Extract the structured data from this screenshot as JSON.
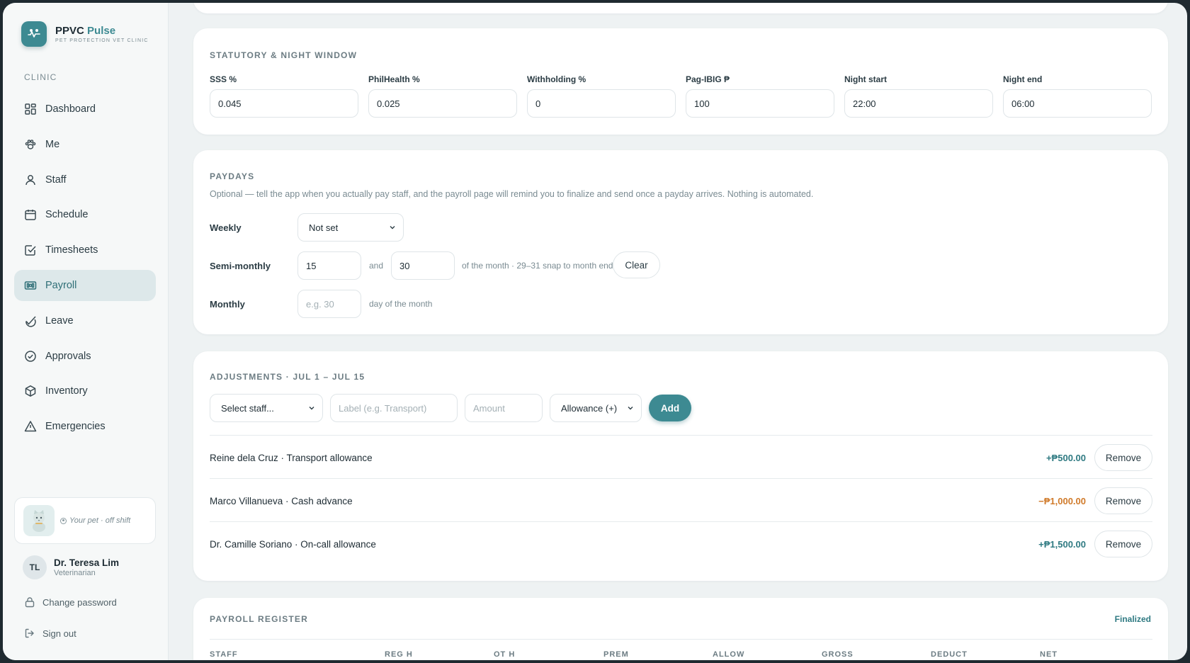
{
  "brand": {
    "name": "PPVC",
    "name_accent": "Pulse",
    "subtitle": "PET PROTECTION VET CLINIC"
  },
  "sidebar": {
    "section_label": "CLINIC",
    "items": [
      {
        "label": "Dashboard",
        "icon": "dashboard-icon"
      },
      {
        "label": "Me",
        "icon": "paw-icon"
      },
      {
        "label": "Staff",
        "icon": "user-icon"
      },
      {
        "label": "Schedule",
        "icon": "calendar-icon"
      },
      {
        "label": "Timesheets",
        "icon": "checkbox-icon"
      },
      {
        "label": "Payroll",
        "icon": "banknote-icon",
        "active": true
      },
      {
        "label": "Leave",
        "icon": "leave-icon"
      },
      {
        "label": "Approvals",
        "icon": "check-circle-icon"
      },
      {
        "label": "Inventory",
        "icon": "box-icon"
      },
      {
        "label": "Emergencies",
        "icon": "warning-icon"
      }
    ],
    "pet_status": "Your pet · off shift",
    "user": {
      "initials": "TL",
      "name": "Dr. Teresa Lim",
      "role": "Veterinarian"
    },
    "change_password": "Change password",
    "sign_out": "Sign out"
  },
  "statutory": {
    "title": "STATUTORY & NIGHT WINDOW",
    "fields": [
      {
        "label": "SSS %",
        "value": "0.045"
      },
      {
        "label": "PhilHealth %",
        "value": "0.025"
      },
      {
        "label": "Withholding %",
        "value": "0"
      },
      {
        "label": "Pag-IBIG ₱",
        "value": "100"
      },
      {
        "label": "Night start",
        "value": "22:00"
      },
      {
        "label": "Night end",
        "value": "06:00"
      }
    ]
  },
  "paydays": {
    "title": "PAYDAYS",
    "description": "Optional — tell the app when you actually pay staff, and the payroll page will remind you to finalize and send once a payday arrives. Nothing is automated.",
    "weekly_label": "Weekly",
    "weekly_value": "Not set",
    "semi_label": "Semi-monthly",
    "semi_first": "15",
    "semi_and": "and",
    "semi_second": "30",
    "semi_hint": "of the month · 29–31 snap to month end",
    "clear_label": "Clear",
    "monthly_label": "Monthly",
    "monthly_placeholder": "e.g. 30",
    "monthly_hint": "day of the month"
  },
  "adjustments": {
    "title": "ADJUSTMENTS · JUL 1 – JUL 15",
    "staff_select": "Select staff...",
    "label_placeholder": "Label (e.g. Transport)",
    "amount_placeholder": "Amount",
    "type_select": "Allowance (+)",
    "add_label": "Add",
    "rows": [
      {
        "text": "Reine dela Cruz · Transport allowance",
        "amount": "+₱500.00",
        "kind": "pos",
        "action": "Remove"
      },
      {
        "text": "Marco Villanueva · Cash advance",
        "amount": "−₱1,000.00",
        "kind": "neg",
        "action": "Remove"
      },
      {
        "text": "Dr. Camille Soriano · On-call allowance",
        "amount": "+₱1,500.00",
        "kind": "pos",
        "action": "Remove"
      }
    ]
  },
  "register": {
    "title": "PAYROLL REGISTER",
    "status": "Finalized",
    "columns": [
      "STAFF",
      "REG H",
      "OT H",
      "PREM",
      "ALLOW",
      "GROSS",
      "DEDUCT",
      "NET"
    ]
  },
  "colors": {
    "accent": "#3d8a92",
    "negative": "#d07a2a",
    "background": "#eef2f3"
  }
}
